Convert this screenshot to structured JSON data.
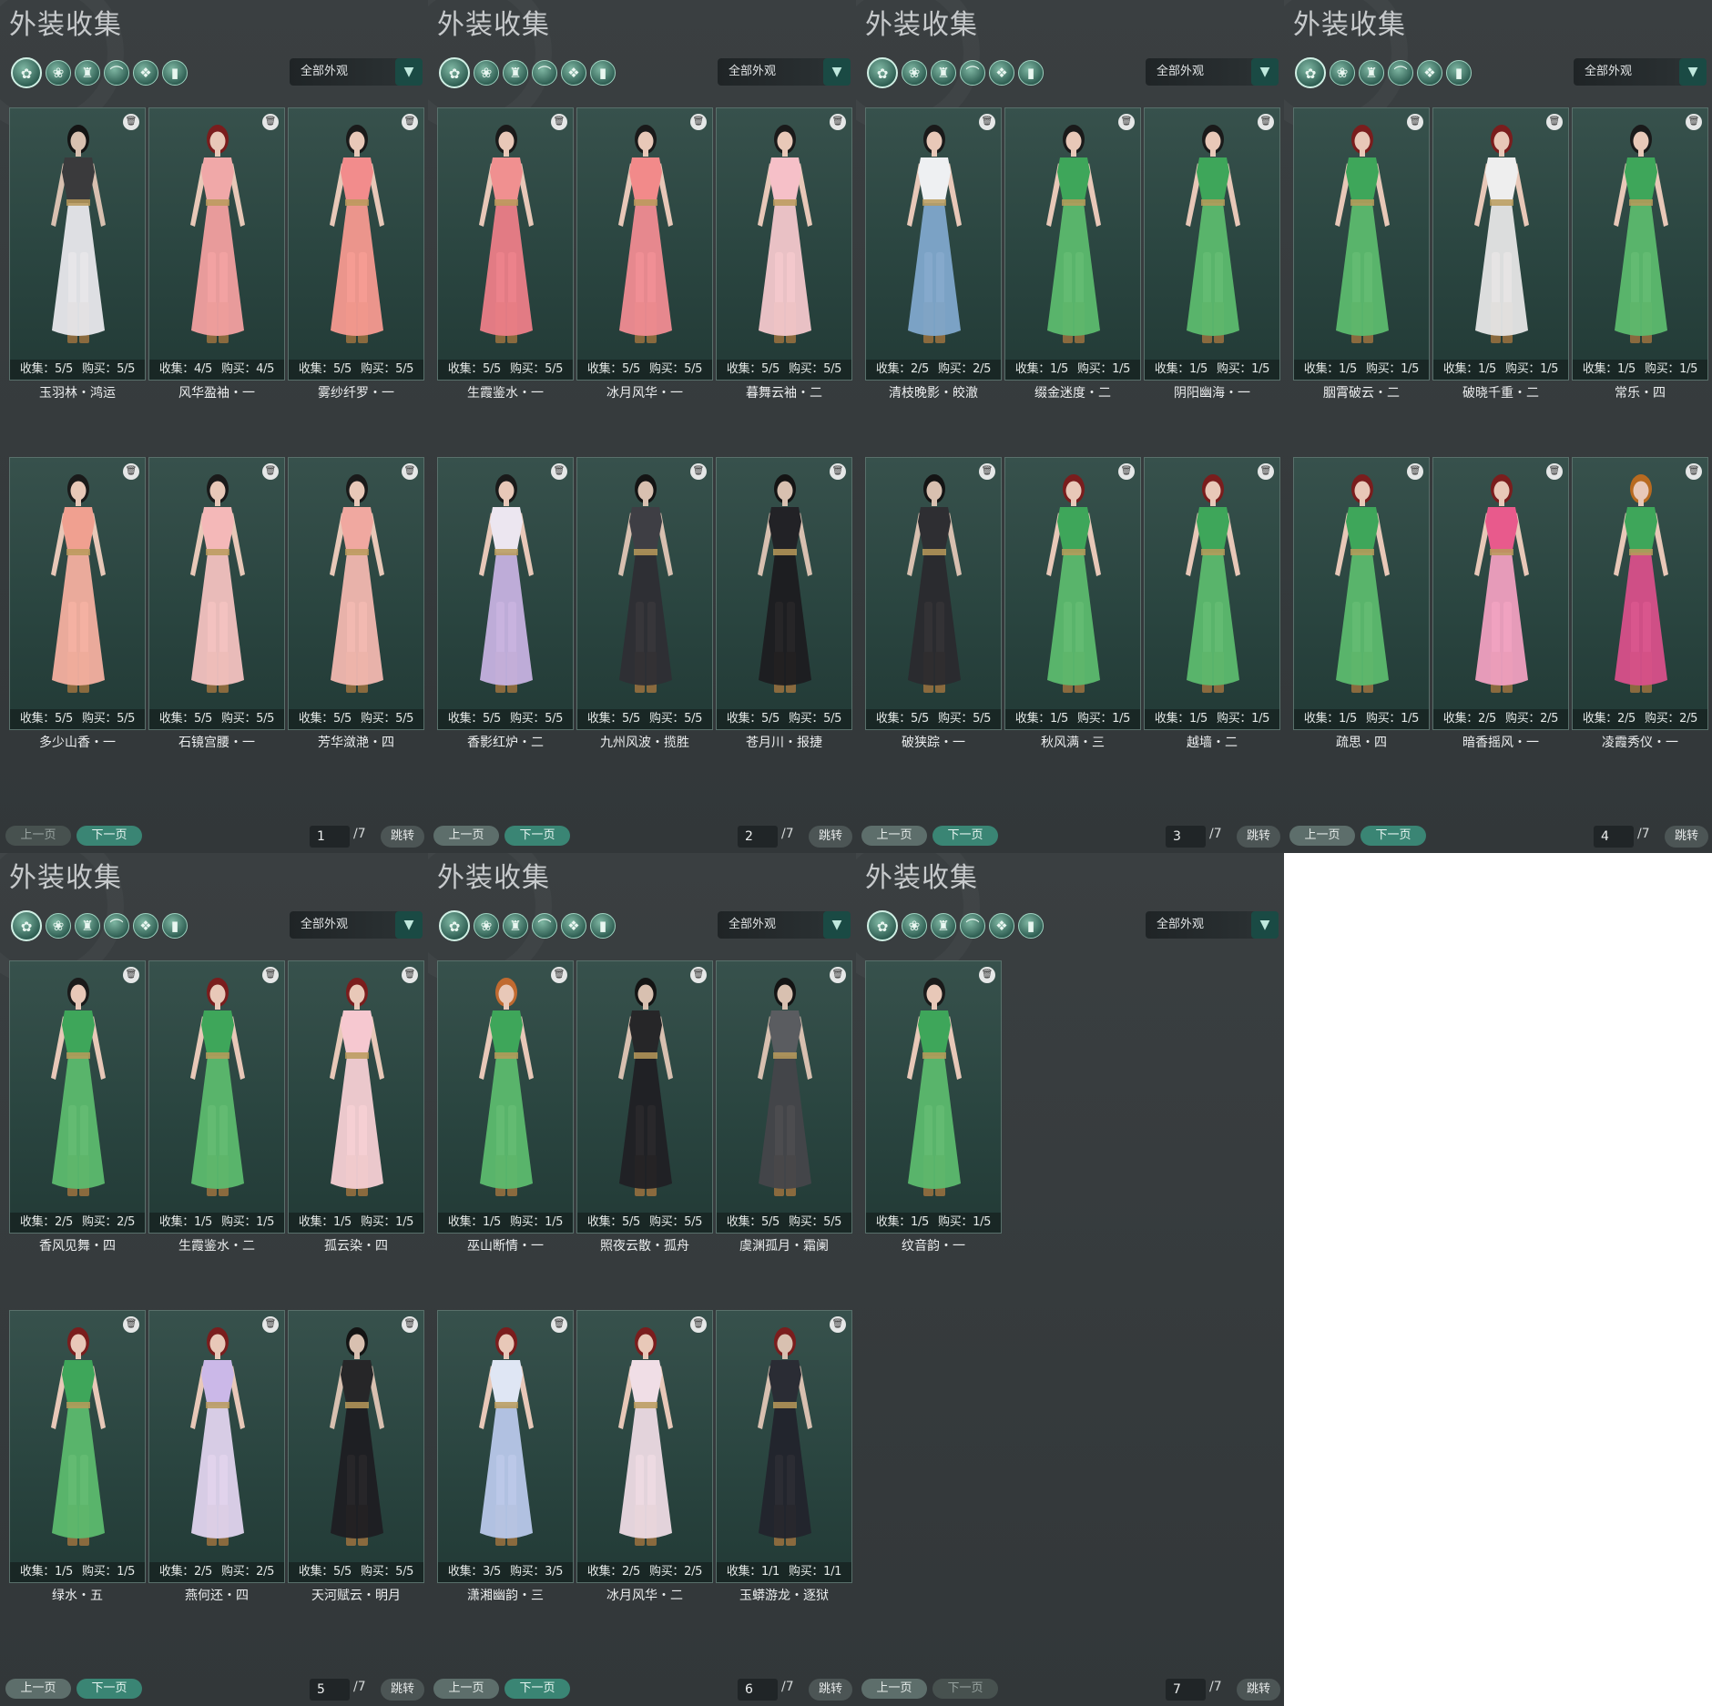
{
  "panels": [
    {
      "title": "外装收集",
      "filter_label": "全部外观",
      "prev_label": "上一页",
      "next_label": "下一页",
      "page_current": "1",
      "page_total": "/7",
      "jump_label": "跳转",
      "cards": [
        {
          "name": "玉羽林・鸿运",
          "collect": "收集：5/5",
          "buy": "购买：5/5",
          "skin": "#d8c0b0",
          "top": "#3a3a3c",
          "bottom": "#e8e8ec",
          "hair": "#141414"
        },
        {
          "name": "风华盈袖・一",
          "collect": "收集：4/5",
          "buy": "购买：4/5",
          "skin": "#e8c8b8",
          "top": "#f0a8a8",
          "bottom": "#f2a0a0",
          "hair": "#7a1d1d"
        },
        {
          "name": "雾纱纤罗・一",
          "collect": "收集：5/5",
          "buy": "购买：5/5",
          "skin": "#e8c8b8",
          "top": "#f28c8c",
          "bottom": "#f59a90",
          "hair": "#1a1a1a"
        },
        {
          "name": "多少山香・一",
          "collect": "收集：5/5",
          "buy": "购买：5/5",
          "skin": "#e8c8b8",
          "top": "#f0a090",
          "bottom": "#f4b0a0",
          "hair": "#1a1a1a"
        },
        {
          "name": "石镜宫腰・一",
          "collect": "收集：5/5",
          "buy": "购买：5/5",
          "skin": "#e8c8b8",
          "top": "#f4b8b8",
          "bottom": "#f3c2c0",
          "hair": "#1a1a1a"
        },
        {
          "name": "芳华潋滟・四",
          "collect": "收集：5/5",
          "buy": "购买：5/5",
          "skin": "#e8c8b8",
          "top": "#f0a8a0",
          "bottom": "#f2b8b0",
          "hair": "#1a1a1a"
        }
      ]
    },
    {
      "title": "外装收集",
      "filter_label": "全部外观",
      "prev_label": "上一页",
      "next_label": "下一页",
      "page_current": "2",
      "page_total": "/7",
      "jump_label": "跳转",
      "cards": [
        {
          "name": "生霞鉴水・一",
          "collect": "收集：5/5",
          "buy": "购买：5/5",
          "skin": "#e8c8b8",
          "top": "#f09090",
          "bottom": "#ec7e88",
          "hair": "#1a1a1a"
        },
        {
          "name": "冰月风华・一",
          "collect": "收集：5/5",
          "buy": "购买：5/5",
          "skin": "#e8c8b8",
          "top": "#f28a8a",
          "bottom": "#f08c92",
          "hair": "#1a1a1a"
        },
        {
          "name": "暮舞云袖・二",
          "collect": "收集：5/5",
          "buy": "购买：5/5",
          "skin": "#e8c8b8",
          "top": "#f6c0c8",
          "bottom": "#f3c8cc",
          "hair": "#1a1a1a"
        },
        {
          "name": "香影红炉・二",
          "collect": "收集：5/5",
          "buy": "购买：5/5",
          "skin": "#e8c8b8",
          "top": "#ece6f0",
          "bottom": "#c6b2e0",
          "hair": "#1a1a1a"
        },
        {
          "name": "九州风波・揽胜",
          "collect": "收集：5/5",
          "buy": "购买：5/5",
          "skin": "#d8c0b0",
          "top": "#3e3e44",
          "bottom": "#2e2e34",
          "hair": "#141414"
        },
        {
          "name": "苍月川・报捷",
          "collect": "收集：5/5",
          "buy": "购买：5/5",
          "skin": "#d8c0b0",
          "top": "#222226",
          "bottom": "#1c1c20",
          "hair": "#141414"
        }
      ]
    },
    {
      "title": "外装收集",
      "filter_label": "全部外观",
      "prev_label": "上一页",
      "next_label": "下一页",
      "page_current": "3",
      "page_total": "/7",
      "jump_label": "跳转",
      "cards": [
        {
          "name": "清枝晚影・皎澈",
          "collect": "收集：2/5",
          "buy": "购买：2/5",
          "skin": "#e8c8b8",
          "top": "#eef0f2",
          "bottom": "#7fa8cc",
          "hair": "#1a1a1a"
        },
        {
          "name": "缀金迷度・二",
          "collect": "收集：1/5",
          "buy": "购买：1/5",
          "skin": "#e8c8b8",
          "top": "#3ea65a",
          "bottom": "#5cbb6e",
          "hair": "#1a1a1a"
        },
        {
          "name": "阴阳幽海・一",
          "collect": "收集：1/5",
          "buy": "购买：1/5",
          "skin": "#e8c8b8",
          "top": "#3ea65a",
          "bottom": "#5cbb6e",
          "hair": "#1a1a1a"
        },
        {
          "name": "破狭踪・一",
          "collect": "收集：5/5",
          "buy": "购买：5/5",
          "skin": "#d8c0b0",
          "top": "#2e2e32",
          "bottom": "#2a2a2e",
          "hair": "#141414"
        },
        {
          "name": "秋风满・三",
          "collect": "收集：1/5",
          "buy": "购买：1/5",
          "skin": "#e8c8b8",
          "top": "#3ea65a",
          "bottom": "#5cbb6e",
          "hair": "#7a1d1d"
        },
        {
          "name": "越墙・二",
          "collect": "收集：1/5",
          "buy": "购买：1/5",
          "skin": "#e8c8b8",
          "top": "#3ea65a",
          "bottom": "#5cbb6e",
          "hair": "#7a1d1d"
        }
      ]
    },
    {
      "title": "外装收集",
      "filter_label": "全部外观",
      "prev_label": "上一页",
      "next_label": "下一页",
      "page_current": "4",
      "page_total": "/7",
      "jump_label": "跳转",
      "cards": [
        {
          "name": "胭霄破云・二",
          "collect": "收集：1/5",
          "buy": "购买：1/5",
          "skin": "#e8c8b8",
          "top": "#3ea65a",
          "bottom": "#5cbb6e",
          "hair": "#7a1d1d"
        },
        {
          "name": "破晓千重・二",
          "collect": "收集：1/5",
          "buy": "购买：1/5",
          "skin": "#e8c8b8",
          "top": "#eeeeee",
          "bottom": "#e6e6e6",
          "hair": "#7a1d1d"
        },
        {
          "name": "常乐・四",
          "collect": "收集：1/5",
          "buy": "购买：1/5",
          "skin": "#e8c8b8",
          "top": "#3ea65a",
          "bottom": "#5cbb6e",
          "hair": "#1a1a1a"
        },
        {
          "name": "疏思・四",
          "collect": "收集：1/5",
          "buy": "购买：1/5",
          "skin": "#e8c8b8",
          "top": "#3ea65a",
          "bottom": "#5cbb6e",
          "hair": "#7a1d1d"
        },
        {
          "name": "暗香摇风・一",
          "collect": "收集：2/5",
          "buy": "购买：2/5",
          "skin": "#e8c8b8",
          "top": "#e85a8c",
          "bottom": "#f0a0c0",
          "hair": "#7a1d1d"
        },
        {
          "name": "凌霞秀仪・一",
          "collect": "收集：2/5",
          "buy": "购买：2/5",
          "skin": "#e8c8b8",
          "top": "#3ea65a",
          "bottom": "#d8508a",
          "hair": "#b86a20"
        }
      ]
    },
    {
      "title": "外装收集",
      "filter_label": "全部外观",
      "prev_label": "上一页",
      "next_label": "下一页",
      "page_current": "5",
      "page_total": "/7",
      "jump_label": "跳转",
      "cards": [
        {
          "name": "香风见舞・四",
          "collect": "收集：2/5",
          "buy": "购买：2/5",
          "skin": "#e8c8b8",
          "top": "#3ea65a",
          "bottom": "#5cbb6e",
          "hair": "#1a1a1a"
        },
        {
          "name": "生霞鉴水・二",
          "collect": "收集：1/5",
          "buy": "购买：1/5",
          "skin": "#e8c8b8",
          "top": "#3ea65a",
          "bottom": "#5cbb6e",
          "hair": "#7a1d1d"
        },
        {
          "name": "孤云染・四",
          "collect": "收集：1/5",
          "buy": "购买：1/5",
          "skin": "#e8c8b8",
          "top": "#f6c8d0",
          "bottom": "#f5d0d4",
          "hair": "#7a1d1d"
        },
        {
          "name": "绿水・五",
          "collect": "收集：1/5",
          "buy": "购买：1/5",
          "skin": "#e8c8b8",
          "top": "#3ea65a",
          "bottom": "#5cbb6e",
          "hair": "#7a1d1d"
        },
        {
          "name": "燕何还・四",
          "collect": "收集：2/5",
          "buy": "购买：2/5",
          "skin": "#e8c8b8",
          "top": "#cbb8e8",
          "bottom": "#e0d4ee",
          "hair": "#7a1d1d"
        },
        {
          "name": "天河赋云・明月",
          "collect": "收集：5/5",
          "buy": "购买：5/5",
          "skin": "#d8c0b0",
          "top": "#262628",
          "bottom": "#1e1e22",
          "hair": "#141414"
        }
      ]
    },
    {
      "title": "外装收集",
      "filter_label": "全部外观",
      "prev_label": "上一页",
      "next_label": "下一页",
      "page_current": "6",
      "page_total": "/7",
      "jump_label": "跳转",
      "cards": [
        {
          "name": "巫山断情・一",
          "collect": "收集：1/5",
          "buy": "购买：1/5",
          "skin": "#e8c8b8",
          "top": "#3ea65a",
          "bottom": "#5cbb6e",
          "hair": "#c06a30"
        },
        {
          "name": "照夜云散・孤舟",
          "collect": "收集：5/5",
          "buy": "购买：5/5",
          "skin": "#d8c0b0",
          "top": "#262628",
          "bottom": "#202024",
          "hair": "#141414"
        },
        {
          "name": "虞渊孤月・霜阑",
          "collect": "收集：5/5",
          "buy": "购买：5/5",
          "skin": "#d8c0b0",
          "top": "#5a5c60",
          "bottom": "#44464a",
          "hair": "#141414"
        },
        {
          "name": "潇湘幽韵・三",
          "collect": "收集：3/5",
          "buy": "购买：3/5",
          "skin": "#e8c8b8",
          "top": "#dfe6f4",
          "bottom": "#b8c8ea",
          "hair": "#7a1d1d"
        },
        {
          "name": "冰月风华・二",
          "collect": "收集：2/5",
          "buy": "购买：2/5",
          "skin": "#e8c8b8",
          "top": "#f0dee6",
          "bottom": "#eddbe4",
          "hair": "#7a1d1d"
        },
        {
          "name": "玉蟒游龙・逐狱",
          "collect": "收集：1/1",
          "buy": "购买：1/1",
          "skin": "#d8c0b0",
          "top": "#2a2c34",
          "bottom": "#22242c",
          "hair": "#7a1d1d"
        }
      ]
    },
    {
      "title": "外装收集",
      "filter_label": "全部外观",
      "prev_label": "上一页",
      "next_label": "下一页",
      "page_current": "7",
      "page_total": "/7",
      "jump_label": "跳转",
      "cards": [
        {
          "name": "纹音韵・一",
          "collect": "收集：1/5",
          "buy": "购买：1/5",
          "skin": "#e8c8b8",
          "top": "#3ea65a",
          "bottom": "#5cbb6e",
          "hair": "#1a1a1a"
        }
      ]
    }
  ],
  "filter_icons": [
    "all-outfits-icon",
    "top-icon",
    "body-icon",
    "shoe-icon",
    "face-icon",
    "bag-icon"
  ],
  "trash_icon": "trash-icon"
}
